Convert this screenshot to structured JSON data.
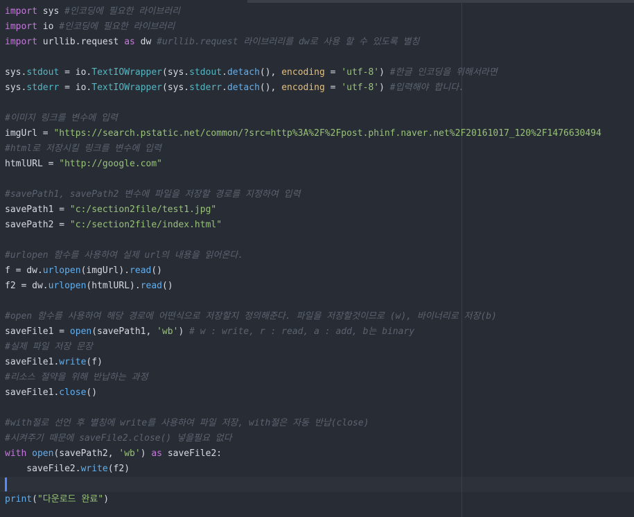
{
  "code": {
    "l1": {
      "kw": "import",
      "rest": " sys ",
      "cm": "#인코딩에 필요한 라이브러리"
    },
    "l2": {
      "kw": "import",
      "rest": " io ",
      "cm": "#인코딩에 필요한 라이브러리"
    },
    "l3": {
      "kw": "import",
      "rest": " urllib.request ",
      "as": "as",
      "rest2": " dw ",
      "cm": "#urllib.request 라이브러리를 dw로 사용 할 수 있도록 별칭"
    },
    "l5": {
      "a": "sys.",
      "b": "stdout",
      "c": " = io.",
      "d": "TextIOWrapper",
      "e": "(sys.",
      "f": "stdout",
      "g": ".",
      "h": "detach",
      "i": "(), ",
      "j": "encoding",
      "k": " = ",
      "l": "'utf-8'",
      "m": ") ",
      "cm": "#한글 인코딩을 위해서라면"
    },
    "l6": {
      "a": "sys.",
      "b": "stderr",
      "c": " = io.",
      "d": "TextIOWrapper",
      "e": "(sys.",
      "f": "stderr",
      "g": ".",
      "h": "detach",
      "i": "(), ",
      "j": "encoding",
      "k": " = ",
      "l": "'utf-8'",
      "m": ") ",
      "cm": "#입력해야 합니다."
    },
    "l8": {
      "cm": "#이미지 링크를 변수에 입력"
    },
    "l9": {
      "a": "imgUrl = ",
      "s": "\"https://search.pstatic.net/common/?src=http%3A%2F%2Fpost.phinf.naver.net%2F20161017_120%2F1476630494"
    },
    "l10": {
      "cm": "#html로 저장시킬 링크를 변수에 입력"
    },
    "l11": {
      "a": "htmlURL = ",
      "s": "\"http://google.com\""
    },
    "l13": {
      "cm": "#savePath1, savePath2 변수에 파일을 저장할 경로를 지정하여 입력"
    },
    "l14": {
      "a": "savePath1 = ",
      "s": "\"c:/section2file/test1.jpg\""
    },
    "l15": {
      "a": "savePath2 = ",
      "s": "\"c:/section2file/index.html\""
    },
    "l17": {
      "cm": "#urlopen 함수를 사용하여 실제 url의 내용을 읽어온다."
    },
    "l18": {
      "a": "f = dw.",
      "b": "urlopen",
      "c": "(imgUrl).",
      "d": "read",
      "e": "()"
    },
    "l19": {
      "a": "f2 = dw.",
      "b": "urlopen",
      "c": "(htmlURL).",
      "d": "read",
      "e": "()"
    },
    "l21": {
      "cm": "#open 함수를 사용하여 해당 경로에 어떤식으로 저장할지 정의해준다. 파일을 저장할것이므로 (w), 바이너리로 저장(b)"
    },
    "l22": {
      "a": "saveFile1 = ",
      "b": "open",
      "c": "(savePath1, ",
      "s": "'wb'",
      "d": ") ",
      "cm": "# w : write, r : read, a : add, b는 binary"
    },
    "l23": {
      "cm": "#실제 파일 저장 문장"
    },
    "l24": {
      "a": "saveFile1.",
      "b": "write",
      "c": "(f)"
    },
    "l25": {
      "cm": "#리소스 절약을 위해 반납하는 과정"
    },
    "l26": {
      "a": "saveFile1.",
      "b": "close",
      "c": "()"
    },
    "l28": {
      "cm": "#with절로 선언 후 별칭에 write를 사용하여 파일 저장, with절은 자동 반납(close)"
    },
    "l29": {
      "cm": "#시켜주기 때문에 saveFile2.close() 넣을필요 없다"
    },
    "l30": {
      "kw": "with",
      "sp": " ",
      "b": "open",
      "c": "(savePath2, ",
      "s": "'wb'",
      "d": ") ",
      "as": "as",
      "e": " saveFile2:"
    },
    "l31": {
      "a": "    saveFile2.",
      "b": "write",
      "c": "(f2)"
    },
    "l33": {
      "b": "print",
      "c": "(",
      "s": "\"다운로드 완료\"",
      "d": ")"
    }
  }
}
